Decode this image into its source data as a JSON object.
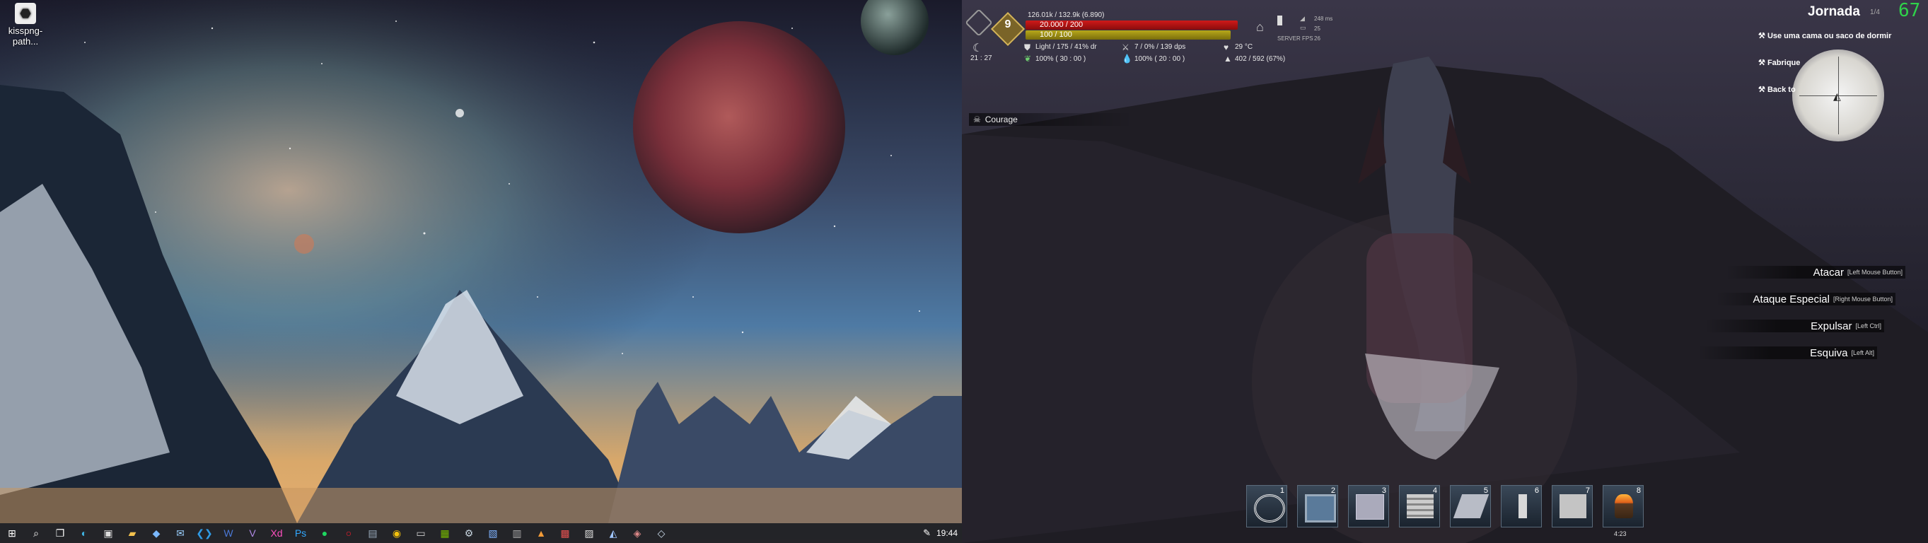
{
  "desktop": {
    "icon_label": "kisspng-path..."
  },
  "taskbar": {
    "icons": [
      "windows-start-icon",
      "search-icon",
      "task-view-icon",
      "edge-icon",
      "store-icon",
      "file-explorer-icon",
      "app-icon",
      "mail-icon",
      "vscode-icon",
      "word-icon",
      "vs-icon",
      "xd-icon",
      "photoshop-icon",
      "spotify-icon",
      "opera-icon",
      "app-icon",
      "chrome-icon",
      "app-icon",
      "steam-icon",
      "app-icon",
      "app-icon",
      "app-icon",
      "app-icon",
      "app-icon",
      "app-icon",
      "app-icon",
      "app-icon",
      "app-icon"
    ],
    "clock": "19:44"
  },
  "hud": {
    "level": "9",
    "xp_text": "126.01k / 132.9k (6.890)",
    "health_text": "20.000 / 200",
    "stamina_text": "100 / 100",
    "health_fraction": 1.0,
    "stamina_fraction": 1.0,
    "time": "21 : 27",
    "armor_text": "Light / 175 / 41% dr",
    "damage_text": "7 / 0% / 139 dps",
    "temperature": "29 °C",
    "food_text": "100% ( 30 : 00 )",
    "water_text": "100% ( 20 : 00 )",
    "weight_text": "402 / 592 (67%)",
    "ping": "248 ms",
    "stat2": "25",
    "server_fps_label": "SERVER FPS",
    "server_fps": "26",
    "fps": "67",
    "buff": "Courage"
  },
  "journey": {
    "title": "Jornada",
    "count": "1/4",
    "items": [
      "Use uma cama ou saco de dormir",
      "Fabrique",
      "Back to"
    ]
  },
  "actions": [
    {
      "label": "Atacar",
      "key": "[Left Mouse Button]"
    },
    {
      "label": "Ataque Especial",
      "key": "[Right Mouse Button]"
    },
    {
      "label": "Expulsar",
      "key": "[Left Ctrl]"
    },
    {
      "label": "Esquiva",
      "key": "[Left Alt]"
    }
  ],
  "hotbar": {
    "slots": [
      "1",
      "2",
      "3",
      "4",
      "5",
      "6",
      "7",
      "8"
    ],
    "ammo": "4:23"
  }
}
